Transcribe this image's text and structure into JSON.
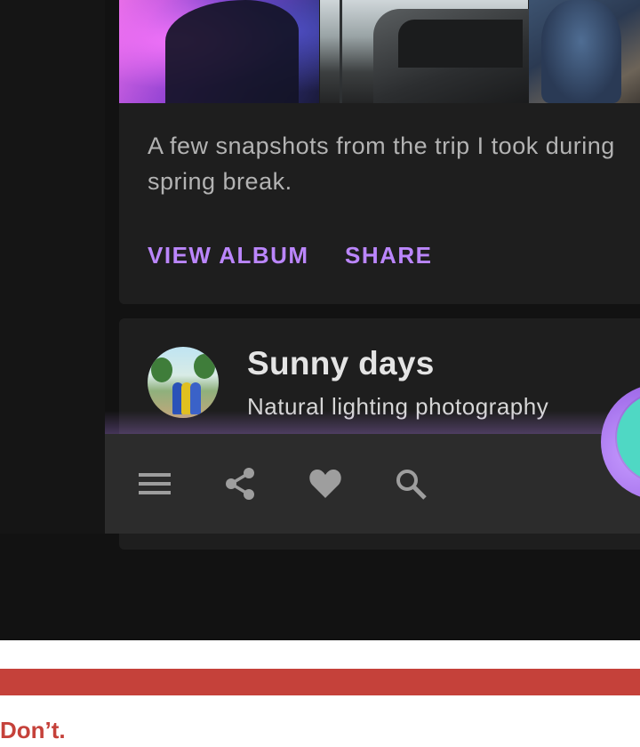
{
  "album_card": {
    "description_line1": "A few snapshots from the trip I took during",
    "description_line2": "spring break.",
    "actions": {
      "view_album": "VIEW ALBUM",
      "share": "SHARE"
    }
  },
  "sunny_card": {
    "title": "Sunny days",
    "subtitle": "Natural lighting photography"
  },
  "bottom_app_bar": {
    "icons": [
      "menu-icon",
      "share-icon",
      "heart-icon",
      "search-icon"
    ]
  },
  "colors": {
    "accent": "#bb86fc",
    "surface": "#1e1e1e",
    "background": "#121212",
    "app_bar": "#2c2c2c",
    "fab": "#4fd8c4",
    "dont_red": "#c5413a"
  },
  "guideline": {
    "label": "Don’t."
  }
}
